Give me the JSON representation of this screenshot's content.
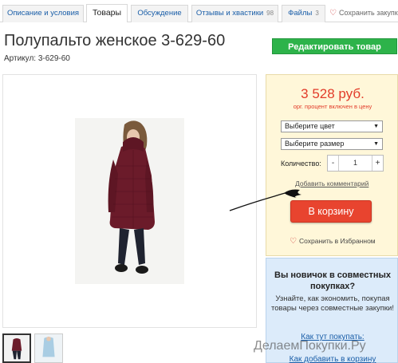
{
  "tabs": [
    {
      "label": "Описание и условия",
      "count": ""
    },
    {
      "label": "Товары",
      "count": ""
    },
    {
      "label": "Обсуждение",
      "count": ""
    },
    {
      "label": "Отзывы и хвастики",
      "count": "98"
    },
    {
      "label": "Файлы",
      "count": "3"
    }
  ],
  "header": {
    "save_purchase": "Сохранить закупку",
    "title": "Полупальто женское 3-629-60",
    "article": "Артикул: 3-629-60",
    "edit_button": "Редактировать товар"
  },
  "buy": {
    "price": "3 528 руб.",
    "price_note": "орг. процент включен в цену",
    "color_select": "Выберите цвет",
    "size_select": "Выберите размер",
    "qty_label": "Количество:",
    "qty_value": "1",
    "minus": "-",
    "plus": "+",
    "add_comment": "Добавить комментарий",
    "cart_button": "В корзину",
    "save_favorites": "Сохранить в Избранном"
  },
  "info": {
    "title": "Вы новичок в совместных покупках?",
    "text": "Узнайте, как экономить, покупая товары через совместные закупки!",
    "link1": "Как тут покупать:",
    "link2": "Как добавить в корзину"
  },
  "watermark": "ДелаемПокупки.Ру",
  "colors": {
    "accent_green": "#2db34a",
    "cart_red": "#e8442f",
    "price_red": "#e23c2a",
    "link_blue": "#1a5ea8"
  },
  "icons": [
    "heart-icon",
    "chevron-down-icon"
  ]
}
